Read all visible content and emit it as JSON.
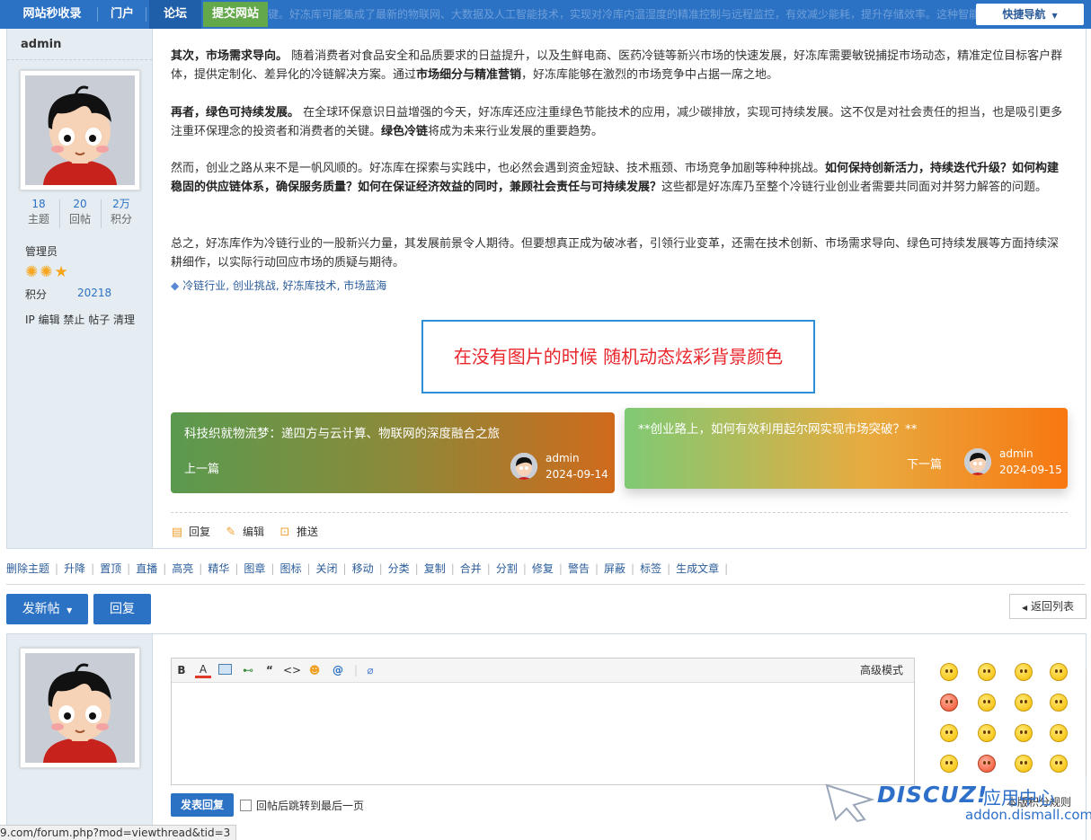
{
  "nav": {
    "site_name": "网站秒收录",
    "portal": "门户",
    "forum": "论坛",
    "submit_site": "提交网站",
    "quick_nav": "快捷导航",
    "ghost_text": "首先，技术创新是关键。好冻库可能集成了最新的物联网、大数据及人工智能技术，实现对冷库内温湿度的精准控制与远程监控，有效减少能耗，提升存储效率。这种智能化管理模式，不仅降低了人力成本，还大大提高了产品的保鲜度和安全性，为消费者带来更加新鲜、健康的体验。"
  },
  "author": {
    "name": "admin",
    "stats": [
      {
        "value": "18",
        "label": "主题"
      },
      {
        "value": "20",
        "label": "回帖"
      },
      {
        "value": "2万",
        "label": "积分"
      }
    ],
    "group": "管理员",
    "points_label": "积分",
    "points_value": "20218",
    "admin_links": "IP 编辑 禁止 帖子 清理"
  },
  "post": {
    "para1_bold": "其次，市场需求导向。",
    "para1_a": " 随着消费者对食品安全和品质要求的日益提升，以及生鲜电商、医药冷链等新兴市场的快速发展，好冻库需要敏锐捕捉市场动态，精准定位目标客户群体，提供定制化、差异化的冷链解决方案。通过",
    "para1_b": "市场细分与精准营销",
    "para1_c": "，好冻库能够在激烈的市场竞争中占据一席之地。",
    "para2_bold": "再者，绿色可持续发展。",
    "para2_a": " 在全球环保意识日益增强的今天，好冻库还应注重绿色节能技术的应用，减少碳排放，实现可持续发展。这不仅是对社会责任的担当，也是吸引更多注重环保理念的投资者和消费者的关键。",
    "para2_b": "绿色冷链",
    "para2_c": "将成为未来行业发展的重要趋势。",
    "para3_a": "然而，创业之路从来不是一帆风顺的。好冻库在探索与实践中，也必然会遇到资金短缺、技术瓶颈、市场竞争加剧等种种挑战。",
    "para3_b": "如何保持创新活力，持续迭代升级？如何构建稳固的供应链体系，确保服务质量？如何在保证经济效益的同时，兼顾社会责任与可持续发展？",
    "para3_c": "这些都是好冻库乃至整个冷链行业创业者需要共同面对并努力解答的问题。",
    "para4": "总之，好冻库作为冷链行业的一股新兴力量，其发展前景令人期待。但要想真正成为破冰者，引领行业变革，还需在技术创新、市场需求导向、绿色可持续发展等方面持续深耕细作，以实际行动回应市场的质疑与期待。",
    "tags": [
      "冷链行业",
      "创业挑战",
      "好冻库技术",
      "市场蓝海"
    ],
    "notice": "在没有图片的时候 随机动态炫彩背景颜色",
    "prev": {
      "title": "科技织就物流梦：递四方与云计算、物联网的深度融合之旅",
      "dir": "上一篇",
      "author": "admin",
      "date": "2024-09-14"
    },
    "next": {
      "title": "**创业路上，如何有效利用起尔网实现市场突破？**",
      "dir": "下一篇",
      "author": "admin",
      "date": "2024-09-15"
    },
    "actions": {
      "reply": "回复",
      "edit": "编辑",
      "push": "推送"
    }
  },
  "modbar": [
    "删除主题",
    "升降",
    "置顶",
    "直播",
    "高亮",
    "精华",
    "图章",
    "图标",
    "关闭",
    "移动",
    "分类",
    "复制",
    "合并",
    "分割",
    "修复",
    "警告",
    "屏蔽",
    "标签",
    "生成文章"
  ],
  "buttons": {
    "new_post": "发新帖",
    "reply": "回复",
    "back_list": "返回列表"
  },
  "editor": {
    "toolbar": [
      "B",
      "A",
      "img",
      "link",
      "“",
      "<>",
      "emoji",
      "@",
      "attach"
    ],
    "advanced": "高级模式",
    "submit": "发表回复",
    "jump_label": "回帖后跳转到最后一页",
    "rules": "本版积分规则"
  },
  "watermark": {
    "brand": "DISCUZ!",
    "cn": "应用中心",
    "url": "addon.dismall.com"
  },
  "status_url": "9.com/forum.php?mod=viewthread&tid=3"
}
